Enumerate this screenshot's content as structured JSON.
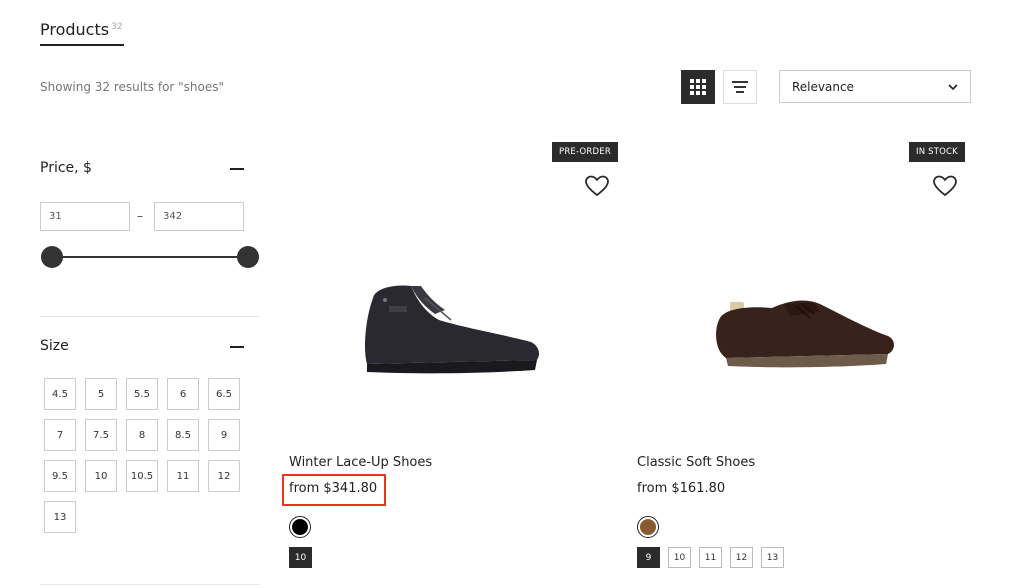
{
  "header": {
    "title": "Products",
    "count": "32"
  },
  "results_text": "Showing 32 results for \"shoes\"",
  "view": {
    "grid_icon": "grid-icon",
    "list_icon": "list-icon",
    "active": "grid"
  },
  "sort": {
    "selected": "Relevance",
    "icon": "chevron-down-icon"
  },
  "filters": {
    "price": {
      "title": "Price, $",
      "min": "31",
      "max": "342",
      "range_separator": "–"
    },
    "size": {
      "title": "Size",
      "options": [
        "4.5",
        "5",
        "5.5",
        "6",
        "6.5",
        "7",
        "7.5",
        "8",
        "8.5",
        "9",
        "9.5",
        "10",
        "10.5",
        "11",
        "12",
        "13"
      ]
    }
  },
  "products": [
    {
      "badge": "PRE-ORDER",
      "name": "Winter Lace-Up Shoes",
      "price": "from $341.80",
      "colors": [
        "#000000"
      ],
      "sizes": [
        "10"
      ],
      "active_size": "10"
    },
    {
      "badge": "IN STOCK",
      "name": "Classic Soft Shoes",
      "price": "from $161.80",
      "colors": [
        "#8a5a32"
      ],
      "sizes": [
        "9",
        "10",
        "11",
        "12",
        "13"
      ],
      "active_size": "9"
    }
  ]
}
